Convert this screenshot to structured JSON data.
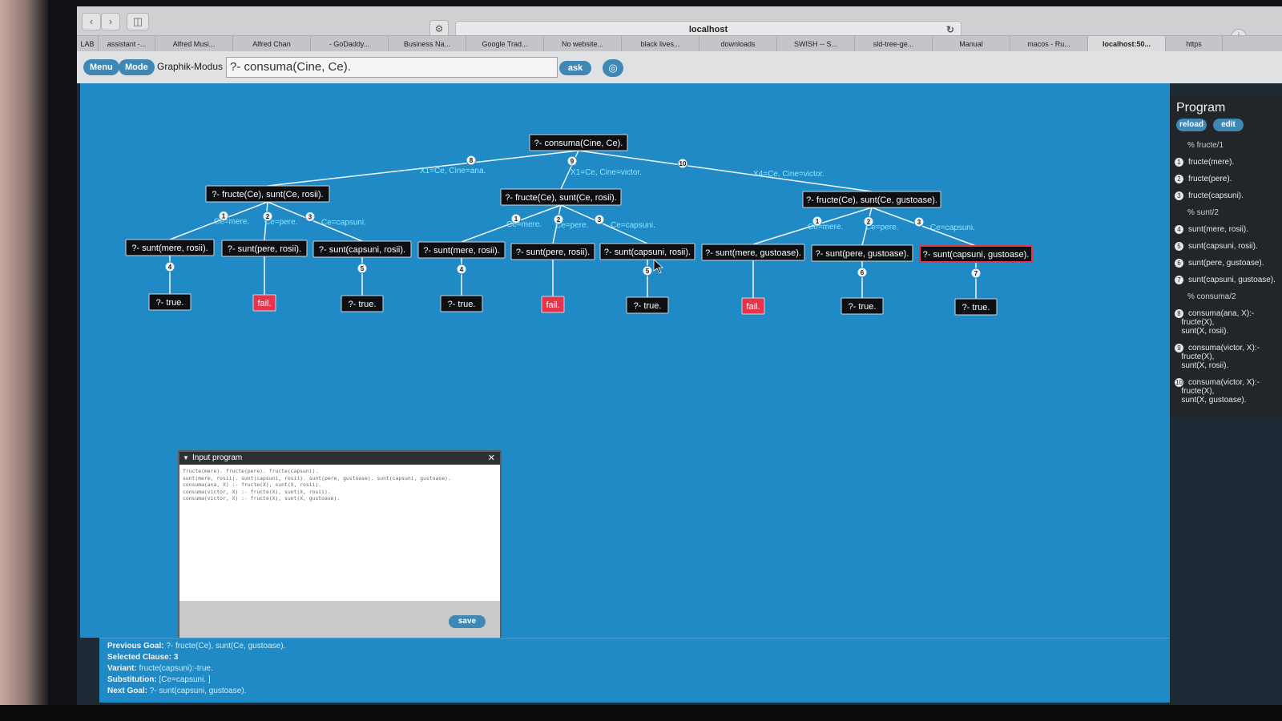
{
  "browser": {
    "address": "localhost",
    "tabs": [
      "LAB",
      "assistant -...",
      "Alfred Musi...",
      "Alfred Chan",
      "- GoDaddy...",
      "Business Na...",
      "Google Trad...",
      "No website...",
      "black lives...",
      "downloads",
      "SWISH -- S...",
      "sld-tree-ge...",
      "Manual",
      "macos - Ru...",
      "localhost:50...",
      "https"
    ],
    "active_tab": "localhost:50...",
    "icons": [
      "back-icon",
      "forward-icon",
      "sidebar-icon",
      "shield-icon",
      "reload-icon",
      "info-icon"
    ]
  },
  "toolbar": {
    "menu_label": "Menu",
    "mode_label": "Mode",
    "graphik_label": "Graphik-Modus",
    "query_value": "?-  consuma(Cine, Ce).",
    "ask_label": "ask",
    "circle_icon": "target-icon"
  },
  "tree": {
    "root": "?- consuma(Cine, Ce).",
    "edge_labels": {
      "root_to_a": "8",
      "root_to_b": "9",
      "root_to_c": "10",
      "b_subst": "X1=Ce, Cine=victor.",
      "a_subst": "X1=Ce, Cine=ana.",
      "c_subst": "X4=Ce, Cine=victor."
    },
    "level1": [
      "?- fructe(Ce), sunt(Ce, rosii).",
      "?- fructe(Ce), sunt(Ce, rosii).",
      "?- fructe(Ce), sunt(Ce, gustoase)."
    ],
    "level1_edges": [
      "1",
      "2",
      "3"
    ],
    "level1_substs": [
      "Ce=mere.",
      "Ce=pere.",
      "Ce=capsuni."
    ],
    "level2": [
      "?- sunt(mere, rosii).",
      "?- sunt(pere, rosii).",
      "?- sunt(capsuni, rosii).",
      "?- sunt(mere, rosii).",
      "?- sunt(pere, rosii).",
      "?- sunt(capsuni, rosii).",
      "?- sunt(mere, gustoase).",
      "?- sunt(pere, gustoase).",
      "?- sunt(capsuni, gustoase)."
    ],
    "level2_edges": [
      "4",
      "",
      "5",
      "4",
      "",
      "5",
      "",
      "6",
      "7"
    ],
    "leaves": [
      "?- true.",
      "fail.",
      "?- true.",
      "?- true.",
      "fail.",
      "?- true.",
      "fail.",
      "?- true.",
      "?- true."
    ],
    "selected_node": "?- sunt(capsuni, gustoase)."
  },
  "program": {
    "title": "Program",
    "reload_label": "reload",
    "edit_label": "edit",
    "clauses": [
      {
        "num": "",
        "text": "% fructe/1",
        "comment": true
      },
      {
        "num": "1",
        "text": "fructe(mere)."
      },
      {
        "num": "2",
        "text": "fructe(pere)."
      },
      {
        "num": "3",
        "text": "fructe(capsuni)."
      },
      {
        "num": "",
        "text": "% sunt/2",
        "comment": true
      },
      {
        "num": "4",
        "text": "sunt(mere, rosii)."
      },
      {
        "num": "5",
        "text": "sunt(capsuni, rosii)."
      },
      {
        "num": "6",
        "text": "sunt(pere, gustoase)."
      },
      {
        "num": "7",
        "text": "sunt(capsuni, gustoase)."
      },
      {
        "num": "",
        "text": "% consuma/2",
        "comment": true
      },
      {
        "num": "8",
        "text": "consuma(ana, X):-\n   fructe(X),\n   sunt(X, rosii)."
      },
      {
        "num": "9",
        "text": "consuma(victor, X):-\n   fructe(X),\n   sunt(X, rosii)."
      },
      {
        "num": "10",
        "text": "consuma(victor, X):-\n   fructe(X),\n   sunt(X, gustoase)."
      }
    ]
  },
  "dialog": {
    "title": "Input program",
    "close_icon": "close-icon",
    "program_text": "fructe(mere). fructe(pere). fructe(capsuni).\nsunt(mere, rosii). sunt(capsuni, rosii). sunt(pere, gustoase). sunt(capsuni, gustoase).\nconsuma(ana, X) :- fructe(X), sunt(X, rosii).\nconsuma(victor, X) :- fructe(X), sunt(X, rosii).\nconsuma(victor, X) :- fructe(X), sunt(X, gustoase).",
    "save_label": "save"
  },
  "status": {
    "previous_goal_label": "Previous Goal:",
    "previous_goal": "?- fructe(Ce), sunt(Ce, gustoase).",
    "selected_clause_label": "Selected Clause:",
    "selected_clause": "3",
    "variant_label": "Variant:",
    "variant": "fructe(capsuni):-true.",
    "substitution_label": "Substitution:",
    "substitution": "[Ce=capsuni. ]",
    "next_goal_label": "Next Goal:",
    "next_goal": "?- sunt(capsuni, gustoase)."
  },
  "colors": {
    "canvas_bg": "#1f8ac6",
    "node_bg": "#0d0f12",
    "fail_bg": "#e8334a",
    "selected_border": "#e8334a",
    "accent_button": "#3f87b5",
    "substitution_text": "#8ee8ff"
  }
}
